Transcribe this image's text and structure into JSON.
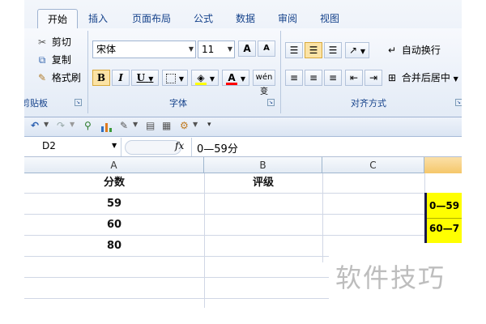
{
  "tabs": [
    "开始",
    "插入",
    "页面布局",
    "公式",
    "数据",
    "审阅",
    "视图"
  ],
  "clipboard": {
    "cut_label": "剪切",
    "copy_label": "复制",
    "format_painter_label": "格式刷",
    "group_label": "剪贴板"
  },
  "font": {
    "name": "宋体",
    "size": "11",
    "bold_label": "B",
    "italic_label": "I",
    "underline_label": "U",
    "grow_label": "A",
    "shrink_label": "A",
    "font_color_label": "A",
    "phonetic_label": "wén 变",
    "group_label": "字体"
  },
  "alignment": {
    "wrap_text_label": "自动换行",
    "merge_center_label": "合并后居中",
    "group_label": "对齐方式"
  },
  "formula_bar": {
    "name_box": "D2",
    "fx_label": "fx",
    "content": "0—59分"
  },
  "columns": [
    "A",
    "B",
    "C"
  ],
  "header_row": {
    "a": "分数",
    "b": "评级"
  },
  "scores": [
    "59",
    "60",
    "80"
  ],
  "side_cells": [
    "0—59",
    "60—7"
  ],
  "colors": {
    "highlight": "#ffff00",
    "selected_column": "#f5c76a",
    "ribbon_text": "#15428b",
    "font_color_bar": "#ff0000",
    "fill_color_bar": "#ffff00"
  },
  "watermark": "软件技巧"
}
